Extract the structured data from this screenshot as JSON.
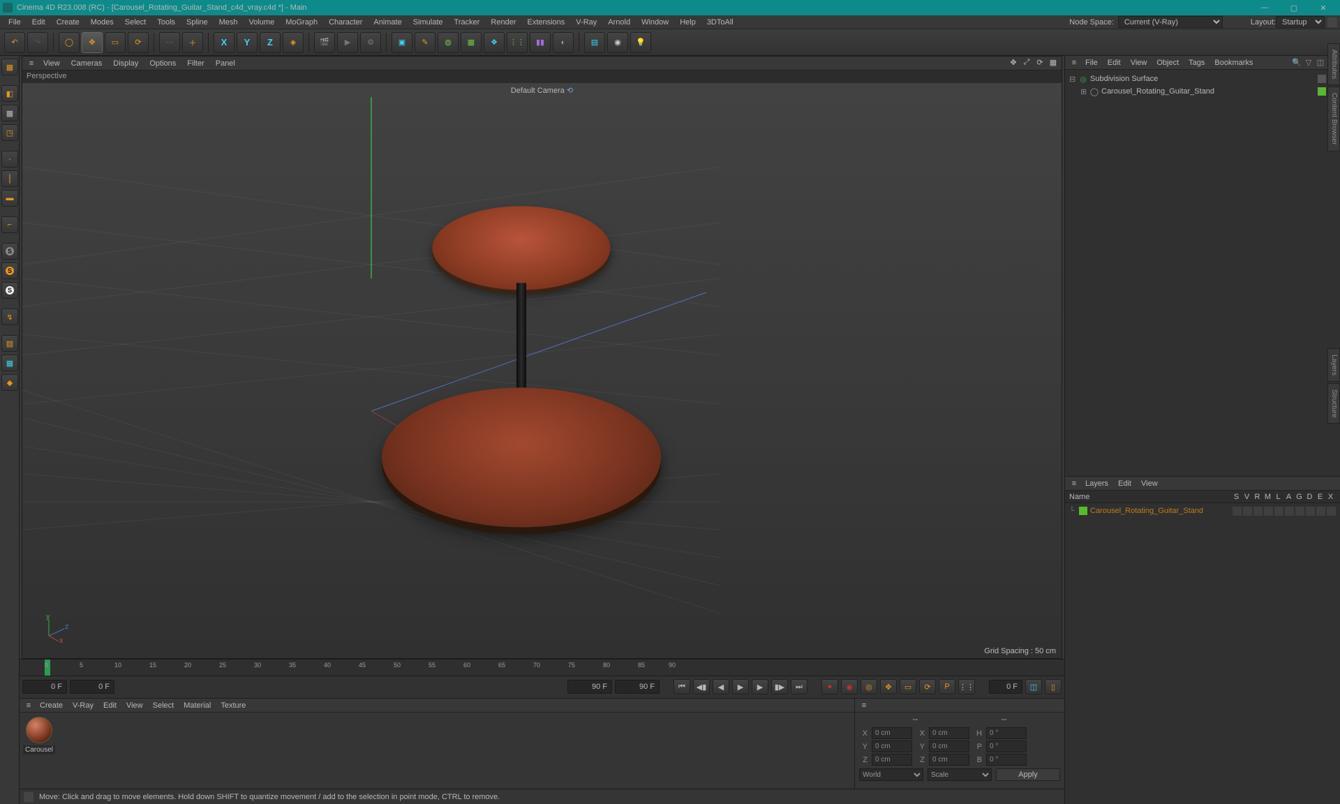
{
  "title": "Cinema 4D R23.008 (RC) - [Carousel_Rotating_Guitar_Stand_c4d_vray.c4d *] - Main",
  "main_menu": [
    "File",
    "Edit",
    "Create",
    "Modes",
    "Select",
    "Tools",
    "Spline",
    "Mesh",
    "Volume",
    "MoGraph",
    "Character",
    "Animate",
    "Simulate",
    "Tracker",
    "Render",
    "Extensions",
    "V-Ray",
    "Arnold",
    "Window",
    "Help",
    "3DToAll"
  ],
  "node_space": {
    "label": "Node Space:",
    "value": "Current (V-Ray)"
  },
  "layout": {
    "label": "Layout:",
    "value": "Startup"
  },
  "viewport_menu": [
    "View",
    "Cameras",
    "Display",
    "Options",
    "Filter",
    "Panel"
  ],
  "viewport_label": "Perspective",
  "viewport_cam_label": "Default Camera",
  "grid_spacing": "Grid Spacing : 50 cm",
  "axis_labels": {
    "x": "x",
    "y": "y",
    "z": "z"
  },
  "timeline": {
    "ticks": [
      0,
      5,
      10,
      15,
      20,
      25,
      30,
      35,
      40,
      45,
      50,
      55,
      60,
      65,
      70,
      75,
      80,
      85,
      90
    ],
    "start": "0 F",
    "end": "90 F",
    "cur_start": "0 F",
    "cur_end": "90 F",
    "field_right": "0 F"
  },
  "materials_menu": [
    "Create",
    "V-Ray",
    "Edit",
    "View",
    "Select",
    "Material",
    "Texture"
  ],
  "material_name": "Carousel",
  "coords": {
    "head_left": "--",
    "head_right": "--",
    "rows": [
      {
        "a": "X",
        "v1": "0 cm",
        "b": "X",
        "v2": "0 cm",
        "c": "H",
        "v3": "0 °"
      },
      {
        "a": "Y",
        "v1": "0 cm",
        "b": "Y",
        "v2": "0 cm",
        "c": "P",
        "v3": "0 °"
      },
      {
        "a": "Z",
        "v1": "0 cm",
        "b": "Z",
        "v2": "0 cm",
        "c": "B",
        "v3": "0 °"
      }
    ],
    "mode1": "World",
    "mode2": "Scale",
    "apply": "Apply"
  },
  "status_hint": "Move: Click and drag to move elements. Hold down SHIFT to quantize movement / add to the selection in point mode, CTRL to remove.",
  "object_mgr_menu": [
    "File",
    "Edit",
    "View",
    "Object",
    "Tags",
    "Bookmarks"
  ],
  "objects": [
    {
      "name": "Subdivision Surface",
      "icon": "sds"
    },
    {
      "name": "Carousel_Rotating_Guitar_Stand",
      "icon": "null",
      "child": true
    }
  ],
  "layers_menu": [
    "Layers",
    "Edit",
    "View"
  ],
  "layer_cols": {
    "name": "Name",
    "flags": [
      "S",
      "V",
      "R",
      "M",
      "L",
      "A",
      "G",
      "D",
      "E",
      "X"
    ]
  },
  "layer_row": {
    "name": "Carousel_Rotating_Guitar_Stand"
  },
  "side_tabs": [
    "Attributes",
    "Content Browser",
    "Layers",
    "Structure"
  ]
}
